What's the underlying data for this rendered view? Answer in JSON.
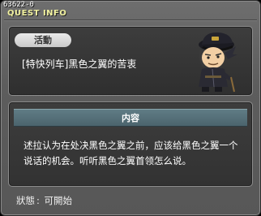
{
  "quest_id": "63622-0",
  "window_title": "QUEST INFO",
  "quest": {
    "category": "活動",
    "name": "[特快列车]黑色之翼的苦衷",
    "npc_icon": "npc-black-wing-officer-portrait"
  },
  "content": {
    "header": "内容",
    "description": "述拉认为在处决黑色之翼之前，应该给黑色之翼一个说话的机会。听听黑色之翼首领怎么说。"
  },
  "status": {
    "label": "狀態",
    "value": "可開始"
  }
}
